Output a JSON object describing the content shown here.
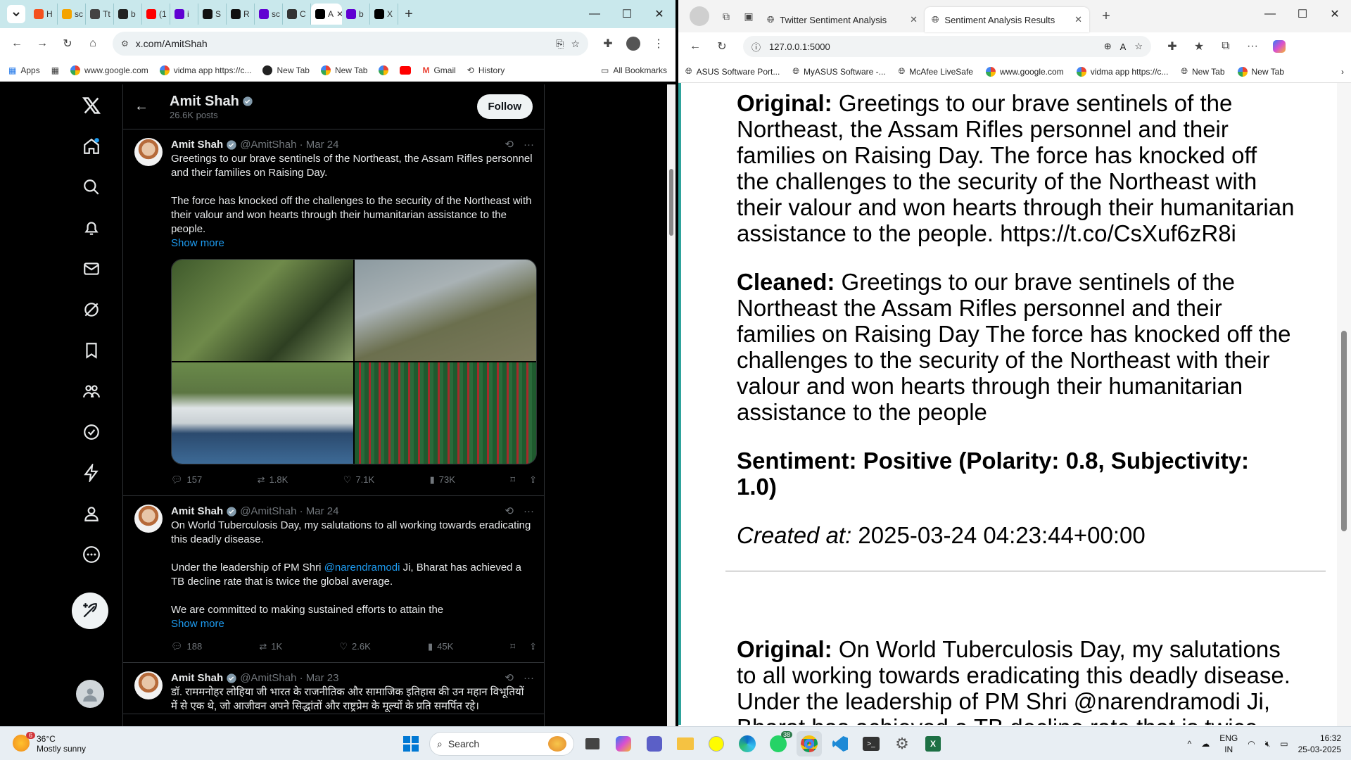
{
  "chrome": {
    "tabs": [
      {
        "label": "H",
        "color": "#f4511e"
      },
      {
        "label": "sc",
        "color": "#f4a400"
      },
      {
        "label": "Tt",
        "color": "#444444"
      },
      {
        "label": "b",
        "color": "#222222"
      },
      {
        "label": "(1",
        "color": "#ff0000"
      },
      {
        "label": "i",
        "color": "#6001d2"
      },
      {
        "label": "S",
        "color": "#111111"
      },
      {
        "label": "R",
        "color": "#111111"
      },
      {
        "label": "sc",
        "color": "#6001d2"
      },
      {
        "label": "C",
        "color": "#333333"
      },
      {
        "label": "A",
        "color": "#000000",
        "active": true
      },
      {
        "label": "b",
        "color": "#6001d2"
      },
      {
        "label": "X",
        "color": "#000000"
      }
    ],
    "url": "x.com/AmitShah",
    "bookmarks": [
      "Apps",
      "www.google.com",
      "vidma app https://c...",
      "New Tab",
      "New Tab",
      "Gmail",
      "History"
    ],
    "all_bookmarks": "All Bookmarks"
  },
  "x": {
    "profile_name": "Amit Shah",
    "post_count": "26.6K posts",
    "follow_label": "Follow",
    "tweets": [
      {
        "name": "Amit Shah",
        "handle": "@AmitShah · Mar 24",
        "text": "Greetings to our brave sentinels of the Northeast, the Assam Rifles personnel and their families on Raising Day.\n\nThe force has knocked off the challenges to the security of the Northeast with their valour and won hearts through their humanitarian assistance to the people.",
        "show_more": "Show more",
        "replies": "157",
        "reposts": "1.8K",
        "likes": "7.1K",
        "views": "73K"
      },
      {
        "name": "Amit Shah",
        "handle": "@AmitShah · Mar 24",
        "text_a": "On World Tuberculosis Day, my salutations to all working towards eradicating this deadly disease.\n\nUnder the leadership of PM Shri ",
        "mention": "@narendramodi",
        "text_b": " Ji, Bharat has achieved a TB decline rate that is twice the global average.\n\nWe are committed to making sustained efforts to attain the",
        "show_more": "Show more",
        "replies": "188",
        "reposts": "1K",
        "likes": "2.6K",
        "views": "45K"
      },
      {
        "name": "Amit Shah",
        "handle": "@AmitShah · Mar 23",
        "text": "डॉ. राममनोहर लोहिया जी भारत के राजनीतिक और सामाजिक इतिहास की उन महान विभूतियों में से एक थे, जो आजीवन अपने सिद्धांतों और राष्ट्रप्रेम के मूल्यों के प्रति समर्पित रहे।"
      }
    ]
  },
  "edge": {
    "tabs": [
      "Twitter Sentiment Analysis",
      "Sentiment Analysis Results"
    ],
    "url": "127.0.0.1:5000",
    "bookmarks": [
      "ASUS Software Port...",
      "MyASUS Software -...",
      "McAfee LiveSafe",
      "www.google.com",
      "vidma app https://c...",
      "New Tab",
      "New Tab"
    ],
    "result1": {
      "original_label": "Original:",
      "original": " Greetings to our brave sentinels of the Northeast, the Assam Rifles personnel and their families on Raising Day. The force has knocked off the challenges to the security of the Northeast with their valour and won hearts through their humanitarian assistance to the people. https://t.co/CsXuf6zR8i",
      "cleaned_label": "Cleaned:",
      "cleaned": " Greetings to our brave sentinels of the Northeast the Assam Rifles personnel and their families on Raising Day The force has knocked off the challenges to the security of the Northeast with their valour and won hearts through their humanitarian assistance to the people",
      "sentiment": "Sentiment: Positive (Polarity: 0.8, Subjectivity: 1.0)",
      "created_label": "Created at:",
      "created": " 2025-03-24 04:23:44+00:00"
    },
    "result2": {
      "original_label": "Original:",
      "original": " On World Tuberculosis Day, my salutations to all working towards eradicating this deadly disease. Under the leadership of PM Shri @narendramodi Ji, Bharat has achieved a TB decline rate that is twice the"
    }
  },
  "taskbar": {
    "temp": "36°C",
    "weather": "Mostly sunny",
    "weather_badge": "6",
    "search_placeholder": "Search",
    "whatsapp_badge": "38",
    "lang1": "ENG",
    "lang2": "IN",
    "time": "16:32",
    "date": "25-03-2025"
  },
  "colors": {
    "x_blue": "#1d9bf0",
    "edge_accent": "#2fa39c",
    "chrome_frame": "#c9e8ec"
  }
}
